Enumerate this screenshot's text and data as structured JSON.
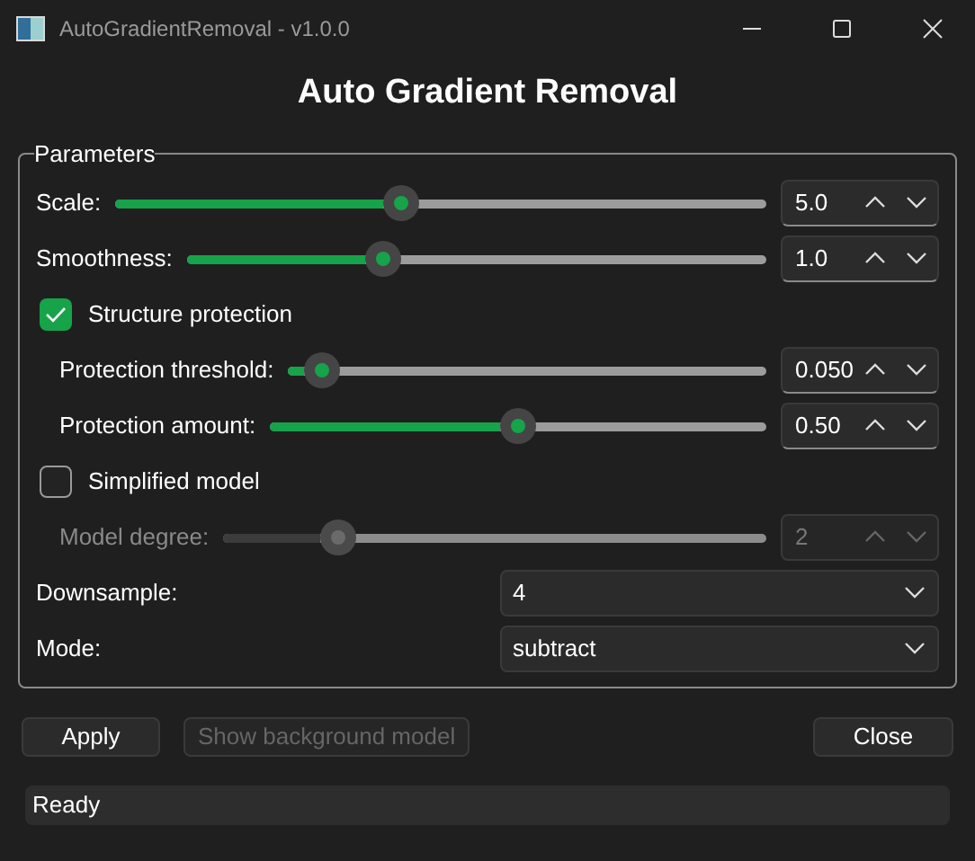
{
  "window": {
    "title": "AutoGradientRemoval - v1.0.0"
  },
  "heading": "Auto Gradient Removal",
  "parameters": {
    "title": "Parameters",
    "rows": [
      {
        "kind": "slider",
        "label": "Scale:",
        "level": 0.44,
        "value": "5.0",
        "disabled": false
      },
      {
        "kind": "slider",
        "label": "Smoothness:",
        "level": 0.34,
        "value": "1.0",
        "disabled": false
      },
      {
        "kind": "checkbox",
        "label": "Structure protection",
        "checked": true,
        "children": [
          {
            "kind": "slider",
            "label": "Protection threshold:",
            "level": 0.07,
            "value": "0.050",
            "disabled": false
          },
          {
            "kind": "slider",
            "label": "Protection amount:",
            "level": 0.5,
            "value": "0.50",
            "disabled": false
          }
        ]
      },
      {
        "kind": "checkbox",
        "label": "Simplified model",
        "checked": false,
        "children": [
          {
            "kind": "slider",
            "label": "Model degree:",
            "level": 0.21,
            "value": "2",
            "disabled": true
          }
        ]
      },
      {
        "kind": "combo",
        "label": "Downsample:",
        "value": "4"
      },
      {
        "kind": "combo",
        "label": "Mode:",
        "value": "subtract"
      }
    ]
  },
  "buttons": [
    {
      "label": "Apply",
      "disabled": false
    },
    {
      "label": "Show background model",
      "disabled": true
    },
    {
      "label": "Close",
      "disabled": false
    }
  ],
  "status_bar": "Ready"
}
